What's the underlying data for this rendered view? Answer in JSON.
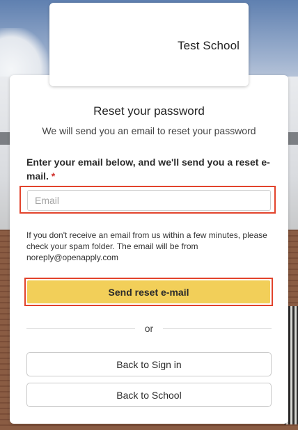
{
  "school": {
    "name": "Test School"
  },
  "reset": {
    "title": "Reset your password",
    "subtitle": "We will send you an email to reset your password",
    "label": "Enter your email below, and we'll send you a reset e-mail.",
    "required_mark": "*",
    "email_placeholder": "Email",
    "email_value": "",
    "notice": "If you don't receive an email from us within a few minutes, please check your spam folder. The email will be from noreply@openapply.com",
    "send_label": "Send reset e-mail",
    "divider_label": "or",
    "back_signin_label": "Back to Sign in",
    "back_school_label": "Back to School"
  },
  "colors": {
    "primary_button": "#f2cf59",
    "highlight_border": "#e2432c",
    "required": "#d0312d"
  }
}
